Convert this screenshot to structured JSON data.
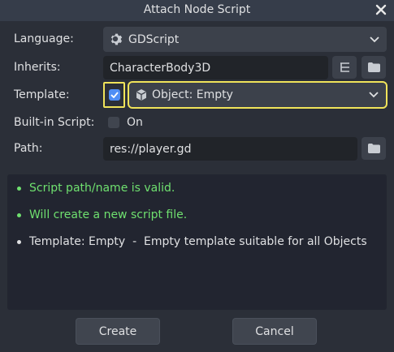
{
  "window": {
    "title": "Attach Node Script"
  },
  "form": {
    "language": {
      "label": "Language:",
      "value": "GDScript",
      "icon": "gear-icon"
    },
    "inherits": {
      "label": "Inherits:",
      "value": "CharacterBody3D"
    },
    "template": {
      "label": "Template:",
      "checked": true,
      "value": "Object: Empty",
      "icon": "cube-icon"
    },
    "builtin": {
      "label": "Built-in Script:",
      "checkbox_label": "On",
      "checked": false
    },
    "path": {
      "label": "Path:",
      "value": "res://player.gd"
    }
  },
  "messages": [
    {
      "text": "Script path/name is valid.",
      "color": "#6fe06f"
    },
    {
      "text": "Will create a new script file.",
      "color": "#6fe06f"
    },
    {
      "text": "Template: Empty  -  Empty template suitable for all Objects",
      "color": "#dfe0e2"
    }
  ],
  "buttons": {
    "create": "Create",
    "cancel": "Cancel"
  },
  "colors": {
    "accent": "#4f8ef5",
    "highlight": "#f0e35a",
    "success": "#6fe06f"
  }
}
